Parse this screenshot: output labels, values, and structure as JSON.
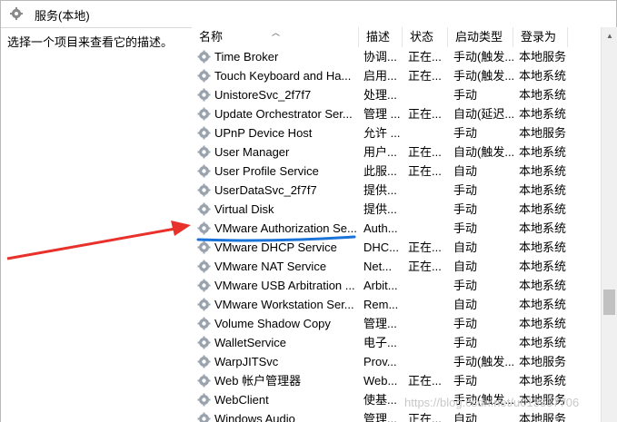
{
  "window": {
    "title": "服务(本地)",
    "title_icon": "gear-icon"
  },
  "description_pane": {
    "text": "选择一个项目来查看它的描述。"
  },
  "columns": {
    "name": "名称",
    "description": "描述",
    "status": "状态",
    "startup_type": "启动类型",
    "log_on_as": "登录为"
  },
  "services": [
    {
      "name": "Time Broker",
      "description": "协调...",
      "status": "正在...",
      "startup_type": "手动(触发...",
      "log_on_as": "本地服务"
    },
    {
      "name": "Touch Keyboard and Ha...",
      "description": "启用...",
      "status": "正在...",
      "startup_type": "手动(触发...",
      "log_on_as": "本地系统"
    },
    {
      "name": "UnistoreSvc_2f7f7",
      "description": "处理...",
      "status": "",
      "startup_type": "手动",
      "log_on_as": "本地系统"
    },
    {
      "name": "Update Orchestrator Ser...",
      "description": "管理 ...",
      "status": "正在...",
      "startup_type": "自动(延迟...",
      "log_on_as": "本地系统"
    },
    {
      "name": "UPnP Device Host",
      "description": "允许 ...",
      "status": "",
      "startup_type": "手动",
      "log_on_as": "本地服务"
    },
    {
      "name": "User Manager",
      "description": "用户...",
      "status": "正在...",
      "startup_type": "自动(触发...",
      "log_on_as": "本地系统"
    },
    {
      "name": "User Profile Service",
      "description": "此服...",
      "status": "正在...",
      "startup_type": "自动",
      "log_on_as": "本地系统"
    },
    {
      "name": "UserDataSvc_2f7f7",
      "description": "提供...",
      "status": "",
      "startup_type": "手动",
      "log_on_as": "本地系统"
    },
    {
      "name": "Virtual Disk",
      "description": "提供...",
      "status": "",
      "startup_type": "手动",
      "log_on_as": "本地系统"
    },
    {
      "name": "VMware Authorization Se...",
      "description": "Auth...",
      "status": "",
      "startup_type": "手动",
      "log_on_as": "本地系统"
    },
    {
      "name": "VMware DHCP Service",
      "description": "DHC...",
      "status": "正在...",
      "startup_type": "自动",
      "log_on_as": "本地系统"
    },
    {
      "name": "VMware NAT Service",
      "description": "Net...",
      "status": "正在...",
      "startup_type": "自动",
      "log_on_as": "本地系统"
    },
    {
      "name": "VMware USB Arbitration ...",
      "description": "Arbit...",
      "status": "",
      "startup_type": "手动",
      "log_on_as": "本地系统"
    },
    {
      "name": "VMware Workstation Ser...",
      "description": "Rem...",
      "status": "",
      "startup_type": "自动",
      "log_on_as": "本地系统"
    },
    {
      "name": "Volume Shadow Copy",
      "description": "管理...",
      "status": "",
      "startup_type": "手动",
      "log_on_as": "本地系统"
    },
    {
      "name": "WalletService",
      "description": "电子...",
      "status": "",
      "startup_type": "手动",
      "log_on_as": "本地系统"
    },
    {
      "name": "WarpJITSvc",
      "description": "Prov...",
      "status": "",
      "startup_type": "手动(触发...",
      "log_on_as": "本地服务"
    },
    {
      "name": "Web 帐户管理器",
      "description": "Web...",
      "status": "正在...",
      "startup_type": "手动",
      "log_on_as": "本地系统"
    },
    {
      "name": "WebClient",
      "description": "使基...",
      "status": "",
      "startup_type": "手动(触发...",
      "log_on_as": "本地服务"
    },
    {
      "name": "Windows Audio",
      "description": "管理...",
      "status": "正在...",
      "startup_type": "自动",
      "log_on_as": "本地服务"
    }
  ],
  "annotation": {
    "arrow_color": "#e8312b",
    "underline_color": "#1a73d9"
  },
  "watermark": {
    "text": "https://blog.csdn.net/u013337706"
  }
}
